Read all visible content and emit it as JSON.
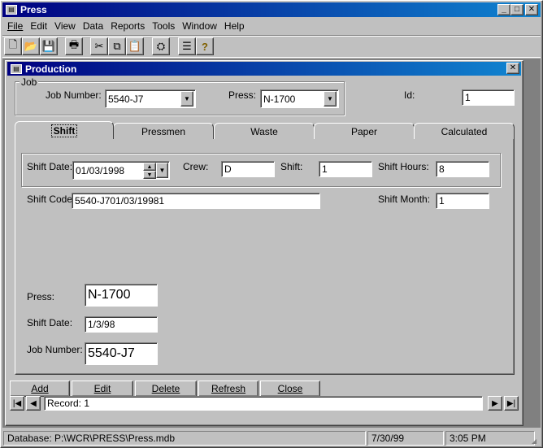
{
  "app": {
    "title": "Press"
  },
  "menu": [
    {
      "label": "File"
    },
    {
      "label": "Edit"
    },
    {
      "label": "View"
    },
    {
      "label": "Data"
    },
    {
      "label": "Reports"
    },
    {
      "label": "Tools"
    },
    {
      "label": "Window"
    },
    {
      "label": "Help"
    }
  ],
  "toolbar": {
    "icons": [
      "new-icon",
      "open-icon",
      "save-icon",
      "print-icon",
      "cut-icon",
      "copy-icon",
      "paste-icon",
      "find-icon",
      "properties-icon",
      "help-icon"
    ]
  },
  "child": {
    "title": "Production"
  },
  "job": {
    "group_label": "Job",
    "job_number_label": "Job Number:",
    "job_number_value": "5540-J7",
    "press_label": "Press:",
    "press_value": "N-1700",
    "id_label": "Id:",
    "id_value": "1"
  },
  "tabs": [
    {
      "label": "Shift",
      "active": true
    },
    {
      "label": "Pressmen"
    },
    {
      "label": "Waste"
    },
    {
      "label": "Paper"
    },
    {
      "label": "Calculated"
    }
  ],
  "shift": {
    "shift_date_label": "Shift Date:",
    "shift_date_value": "01/03/1998",
    "crew_label": "Crew:",
    "crew_value": "D",
    "shift_label": "Shift:",
    "shift_value": "1",
    "shift_hours_label": "Shift Hours:",
    "shift_hours_value": "8",
    "shift_code_label": "Shift Code:",
    "shift_code_value": "5540-J701/03/19981",
    "shift_month_label": "Shift Month:",
    "shift_month_value": "1",
    "lower_press_label": "Press:",
    "lower_press_value": "N-1700",
    "lower_date_label": "Shift Date:",
    "lower_date_value": "1/3/98",
    "lower_job_label": "Job Number:",
    "lower_job_value": "5540-J7"
  },
  "buttons": {
    "add": "Add",
    "edit": "Edit",
    "delete": "Delete",
    "refresh": "Refresh",
    "close": "Close"
  },
  "navigator": {
    "record_text": "Record: 1"
  },
  "status": {
    "database": "Database:  P:\\WCR\\PRESS\\Press.mdb",
    "date": "7/30/99",
    "time": "3:05 PM"
  }
}
